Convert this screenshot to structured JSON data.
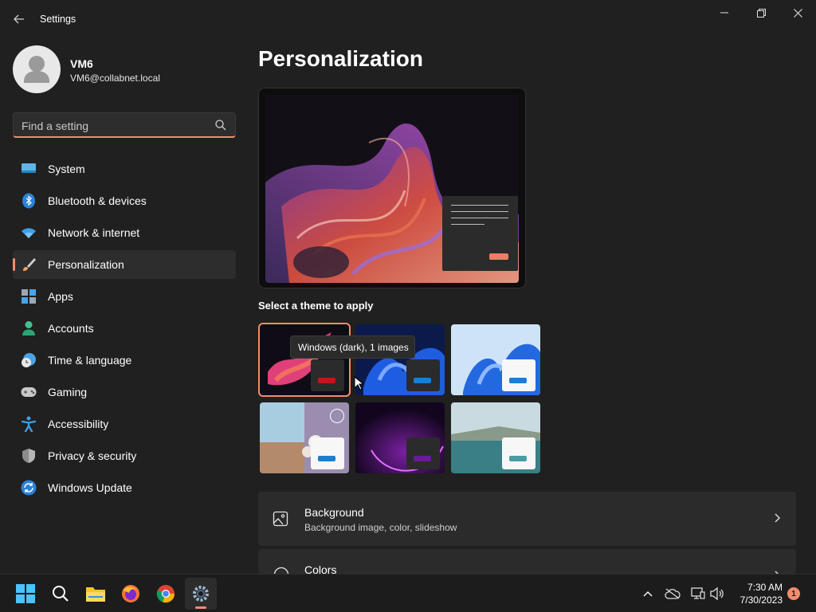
{
  "window": {
    "title": "Settings",
    "controls": {
      "minimize": "minimize-icon",
      "restore": "restore-icon",
      "close": "close-icon"
    }
  },
  "profile": {
    "name": "VM6",
    "email": "VM6@collabnet.local"
  },
  "search": {
    "placeholder": "Find a setting"
  },
  "sidebar": {
    "items": [
      {
        "label": "System",
        "icon": "monitor-icon"
      },
      {
        "label": "Bluetooth & devices",
        "icon": "bluetooth-icon"
      },
      {
        "label": "Network & internet",
        "icon": "wifi-icon"
      },
      {
        "label": "Personalization",
        "icon": "brush-icon",
        "active": true
      },
      {
        "label": "Apps",
        "icon": "apps-icon"
      },
      {
        "label": "Accounts",
        "icon": "person-icon"
      },
      {
        "label": "Time & language",
        "icon": "clock-globe-icon"
      },
      {
        "label": "Gaming",
        "icon": "gamepad-icon"
      },
      {
        "label": "Accessibility",
        "icon": "accessibility-icon"
      },
      {
        "label": "Privacy & security",
        "icon": "shield-icon"
      },
      {
        "label": "Windows Update",
        "icon": "update-icon"
      }
    ]
  },
  "main": {
    "title": "Personalization",
    "themes_label": "Select a theme to apply",
    "tooltip": "Windows (dark), 1 images",
    "cards": [
      {
        "title": "Background",
        "subtitle": "Background image, color, slideshow",
        "icon": "image-icon"
      },
      {
        "title": "Colors",
        "subtitle": "",
        "icon": "palette-icon"
      }
    ]
  },
  "taskbar": {
    "apps": [
      "start-icon",
      "search-icon",
      "file-explorer-icon",
      "firefox-icon",
      "chrome-icon",
      "settings-icon"
    ],
    "time": "7:30 AM",
    "date": "7/30/2023",
    "notification_count": "1"
  },
  "colors": {
    "accent": "#f28c6b",
    "background": "#202020",
    "card": "#2b2b2b"
  }
}
